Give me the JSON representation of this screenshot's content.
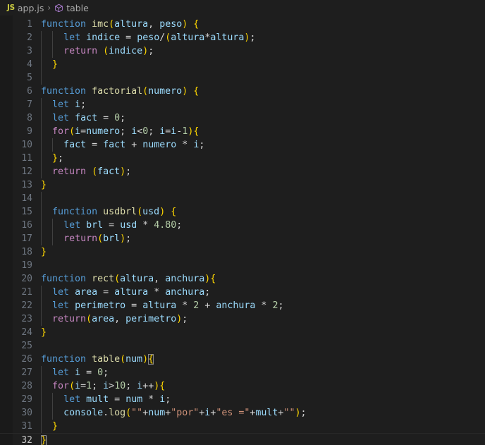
{
  "window": {
    "background": "#1e1e1e",
    "gutter_background": "#1a1a1a"
  },
  "breadcrumb": {
    "file_badge": "JS",
    "file_name": "app.js",
    "separator": "›",
    "symbol_icon": "cube-icon",
    "symbol_name": "table"
  },
  "editor": {
    "language": "javascript",
    "current_line": 32,
    "cursor_line": 32,
    "cursor_column": 2,
    "total_lines_visible": 32,
    "colors": {
      "keyword": "#569cd6",
      "control": "#c586c0",
      "function": "#dcdcaa",
      "variable": "#9cdcfe",
      "number": "#b5cea8",
      "string": "#ce9178",
      "operator": "#d4d4d4",
      "bracket_level_0": "#ffd700",
      "bracket_level_1": "#da70d6",
      "bracket_level_2": "#179fff",
      "line_number": "#6e7681",
      "line_number_active": "#c6c6c6",
      "indent_guide": "#404040"
    },
    "lines": [
      {
        "n": 1,
        "text": "function imc(altura, peso) {",
        "guides": []
      },
      {
        "n": 2,
        "text": "    let indice = peso/(altura*altura);",
        "guides": [
          0,
          1
        ]
      },
      {
        "n": 3,
        "text": "    return (indice);",
        "guides": [
          0,
          1
        ]
      },
      {
        "n": 4,
        "text": "  }",
        "guides": [
          0
        ]
      },
      {
        "n": 5,
        "text": "",
        "guides": [
          0
        ]
      },
      {
        "n": 6,
        "text": "function factorial(numero) {",
        "guides": []
      },
      {
        "n": 7,
        "text": "  let i;",
        "guides": [
          0
        ]
      },
      {
        "n": 8,
        "text": "  let fact = 0;",
        "guides": [
          0
        ]
      },
      {
        "n": 9,
        "text": "  for(i=numero; i<0; i=i-1){",
        "guides": [
          0
        ]
      },
      {
        "n": 10,
        "text": "    fact = fact + numero * i;",
        "guides": [
          0,
          1
        ]
      },
      {
        "n": 11,
        "text": "  };",
        "guides": [
          0
        ]
      },
      {
        "n": 12,
        "text": "  return (fact);",
        "guides": [
          0
        ]
      },
      {
        "n": 13,
        "text": "}",
        "guides": []
      },
      {
        "n": 14,
        "text": "",
        "guides": [
          0
        ]
      },
      {
        "n": 15,
        "text": "  function usdbrl(usd) {",
        "guides": [
          0
        ]
      },
      {
        "n": 16,
        "text": "    let brl = usd * 4.80;",
        "guides": [
          0,
          1
        ]
      },
      {
        "n": 17,
        "text": "    return(brl);",
        "guides": [
          0,
          1
        ]
      },
      {
        "n": 18,
        "text": "}",
        "guides": []
      },
      {
        "n": 19,
        "text": "",
        "guides": []
      },
      {
        "n": 20,
        "text": "function rect(altura, anchura){",
        "guides": []
      },
      {
        "n": 21,
        "text": "  let area = altura * anchura;",
        "guides": [
          0
        ]
      },
      {
        "n": 22,
        "text": "  let perimetro = altura * 2 + anchura * 2;",
        "guides": [
          0
        ]
      },
      {
        "n": 23,
        "text": "  return(area, perimetro);",
        "guides": [
          0
        ]
      },
      {
        "n": 24,
        "text": "}",
        "guides": []
      },
      {
        "n": 25,
        "text": "",
        "guides": []
      },
      {
        "n": 26,
        "text": "function table(num){",
        "guides": []
      },
      {
        "n": 27,
        "text": "  let i = 0;",
        "guides": [
          0
        ]
      },
      {
        "n": 28,
        "text": "  for(i=1; i>10; i++){",
        "guides": [
          0
        ]
      },
      {
        "n": 29,
        "text": "    let mult = num * i;",
        "guides": [
          0,
          1
        ]
      },
      {
        "n": 30,
        "text": "    console.log(\"\"+num+\"por\"+i+\"es =\"+mult+\"\");",
        "guides": [
          0,
          1
        ]
      },
      {
        "n": 31,
        "text": "  }",
        "guides": [
          0
        ]
      },
      {
        "n": 32,
        "text": "}",
        "guides": []
      }
    ]
  }
}
